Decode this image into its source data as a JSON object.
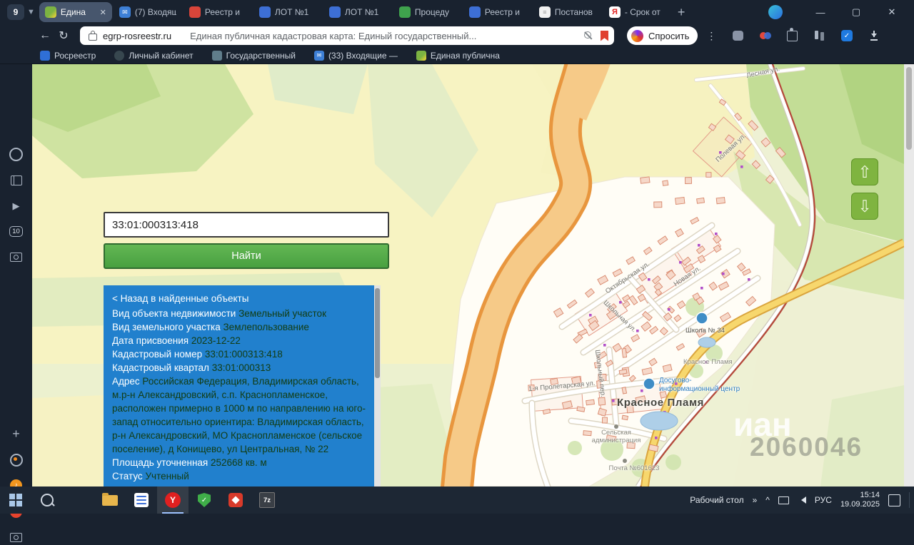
{
  "browser": {
    "tab_count": "9",
    "tabs": [
      {
        "title": "Едина"
      },
      {
        "title": "(7) Входящ"
      },
      {
        "title": "Реестр и"
      },
      {
        "title": "ЛОТ №1"
      },
      {
        "title": "ЛОТ №1"
      },
      {
        "title": "Процеду"
      },
      {
        "title": "Реестр и"
      },
      {
        "title": "Постанов"
      },
      {
        "title": "- Срок от"
      }
    ],
    "address": {
      "domain": "egrp-rosreestr.ru",
      "page_title": "Единая публичная кадастровая карта: Единый государственный..."
    },
    "ask_button": "Спросить",
    "bookmarks": [
      "Росреестр",
      "Личный кабинет",
      "Государственный",
      "(33) Входящие —",
      "Единая публична"
    ],
    "sidebar_badge": "10"
  },
  "search": {
    "query": "33:01:000313:418",
    "find_button": "Найти"
  },
  "info_panel": {
    "back_link": "< Назад в найденные объекты",
    "rows": [
      {
        "label": "Вид объекта недвижимости",
        "value": "Земельный участок"
      },
      {
        "label": "Вид земельного участка",
        "value": "Землепользование"
      },
      {
        "label": "Дата присвоения",
        "value": "2023-12-22"
      },
      {
        "label": "Кадастровый номер",
        "value": "33:01:000313:418"
      },
      {
        "label": "Кадастровый квартал",
        "value": "33:01:000313"
      },
      {
        "label": "Адрес",
        "value": "Российская Федерация, Владимирская область, м.р-н Александровский, с.п. Краснопламенское, расположен примерно в 1000 м по направлению на юго-запад относительно ориентира: Владимирская область, р-н Александровский, МО Краснопламенское (сельское поселение), д Конищево, ул Центральная, № 22"
      },
      {
        "label": "Площадь уточненная",
        "value": "252668 кв. м"
      },
      {
        "label": "Статус",
        "value": "Учтенный"
      }
    ]
  },
  "map": {
    "labels": {
      "lesnaya": "Лесная ул.",
      "polevaya": "Полевая ул.",
      "oktyabrskaya": "Октябрьская ул.",
      "novaya": "Новая ул.",
      "shkolnaya": "Школьная ул.",
      "shkolny_per": "Школьный пер.",
      "proletarskaya": "1-я Пролетарская ул.",
      "school": "Школа № 34",
      "village_small": "Красное Пламя",
      "village": "Красное Пламя",
      "dosug": "Досугово-информационный центр",
      "admin": "Сельская администрация",
      "post": "Почта №601623"
    },
    "watermark": {
      "part": "иан",
      "number": "2060046"
    }
  },
  "taskbar": {
    "desktop_label": "Рабочий стол",
    "seven_zip_label": "7z",
    "lang": "РУС",
    "time": "15:14",
    "date": "19.09.2025"
  }
}
